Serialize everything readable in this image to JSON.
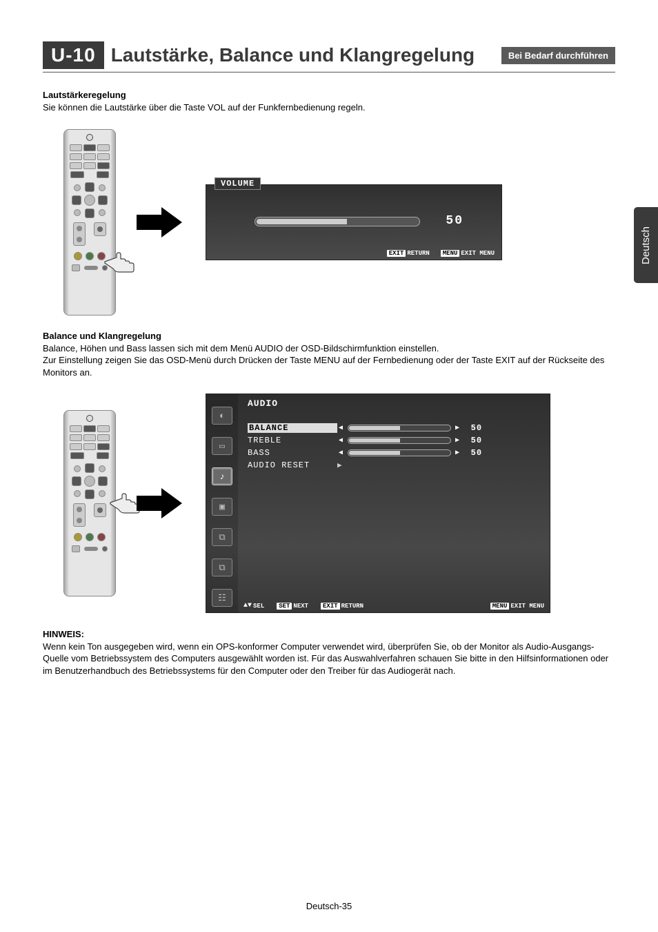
{
  "header": {
    "badge": "U-10",
    "title": "Lautstärke, Balance und Klangregelung",
    "sub_badge": "Bei Bedarf durchführen"
  },
  "lang_tab": "Deutsch",
  "section1": {
    "heading": "Lautstärkeregelung",
    "text": "Sie können die Lautstärke über die Taste VOL auf der Funkfernbedienung regeln."
  },
  "volume_osd": {
    "label": "VOLUME",
    "value": "50",
    "footer_exit_key": "EXIT",
    "footer_exit_label": "RETURN",
    "footer_menu_key": "MENU",
    "footer_menu_label": "EXIT MENU"
  },
  "section2": {
    "heading": "Balance und Klangregelung",
    "line1": "Balance, Höhen und Bass lassen sich mit dem Menü AUDIO der OSD-Bildschirmfunktion einstellen.",
    "line2": "Zur Einstellung zeigen Sie das OSD-Menü durch Drücken der Taste MENU auf der Fernbedienung oder der Taste EXIT auf der Rückseite des Monitors an."
  },
  "audio_osd": {
    "title": "AUDIO",
    "items": [
      {
        "name": "BALANCE",
        "value": "50",
        "slider": true,
        "highlight": true
      },
      {
        "name": "TREBLE",
        "value": "50",
        "slider": true,
        "highlight": false
      },
      {
        "name": "BASS",
        "value": "50",
        "slider": true,
        "highlight": false
      },
      {
        "name": "AUDIO RESET",
        "value": "",
        "slider": false,
        "highlight": false
      }
    ],
    "bottombar": {
      "sel": "SEL",
      "set_key": "SET",
      "set_label": "NEXT",
      "exit_key": "EXIT",
      "exit_label": "RETURN",
      "menu_key": "MENU",
      "menu_label": "EXIT MENU"
    }
  },
  "hinweis": {
    "heading": "HINWEIS:",
    "text": "Wenn kein Ton ausgegeben wird, wenn ein OPS-konformer Computer verwendet wird, überprüfen Sie, ob der Monitor als Audio-Ausgangs-Quelle vom Betriebssystem des Computers ausgewählt worden ist. Für das Auswahlverfahren schauen Sie bitte in den Hilfsinformationen oder im Benutzerhandbuch des Betriebssystems für den Computer oder den Treiber für das Audiogerät nach."
  },
  "page_number": "Deutsch-35"
}
